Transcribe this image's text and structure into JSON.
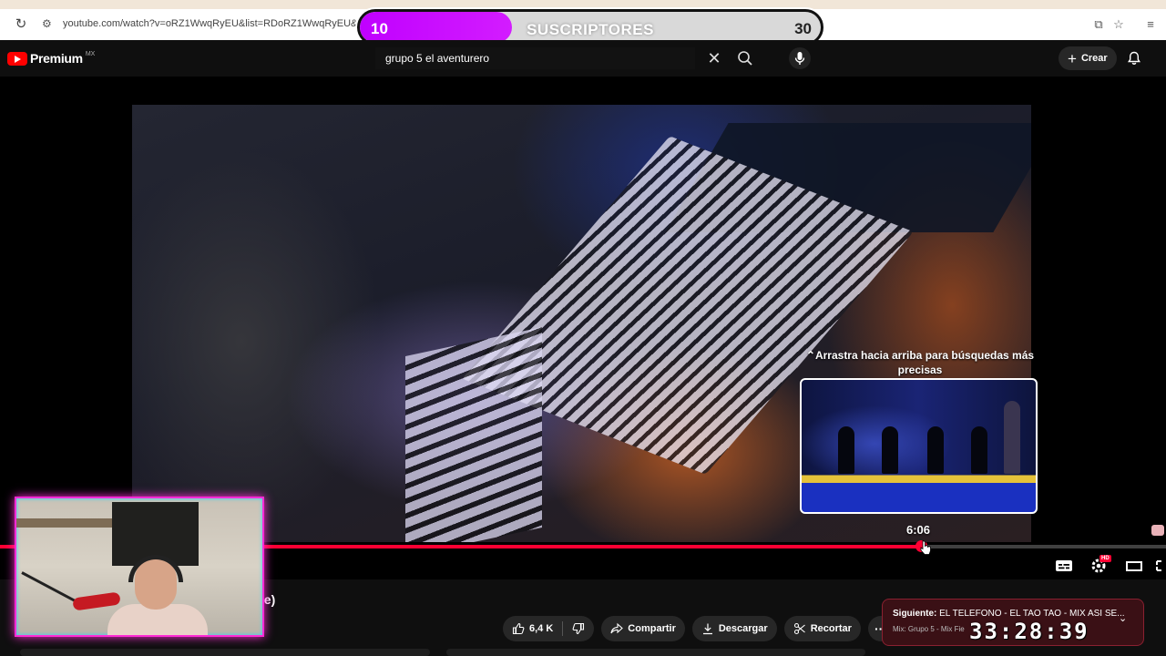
{
  "browser": {
    "url": "youtube.com/watch?v=oRZ1WwqRyEU&list=RDoRZ1WwqRyEU&start_ra"
  },
  "subscriber_goal": {
    "current": "10",
    "label": "SUSCRIPTORES",
    "target": "30",
    "progress_fraction": 0.33,
    "fill_color": "#c000ff"
  },
  "youtube": {
    "logo_text": "Premium",
    "region": "MX",
    "search_value": "grupo 5 el aventurero",
    "create_label": "Crear"
  },
  "player": {
    "seek_hint": "⌃Arrastra hacia arriba para búsquedas más precisas",
    "preview_time": "6:06",
    "progress_fraction": 0.79,
    "accent_color": "#ff0033",
    "hd_badge": "HD"
  },
  "video": {
    "title_fragment": "ile)"
  },
  "actions": {
    "likes": "6,4 K",
    "share": "Compartir",
    "download": "Descargar",
    "clip": "Recortar",
    "more": "···"
  },
  "next_up": {
    "label": "Siguiente:",
    "title": "EL TELEFONO - EL TAO TAO - MIX ASI SE...",
    "subtitle": "Mix: Grupo 5 - Mix Fie"
  },
  "stream_clock": "33:28:39"
}
